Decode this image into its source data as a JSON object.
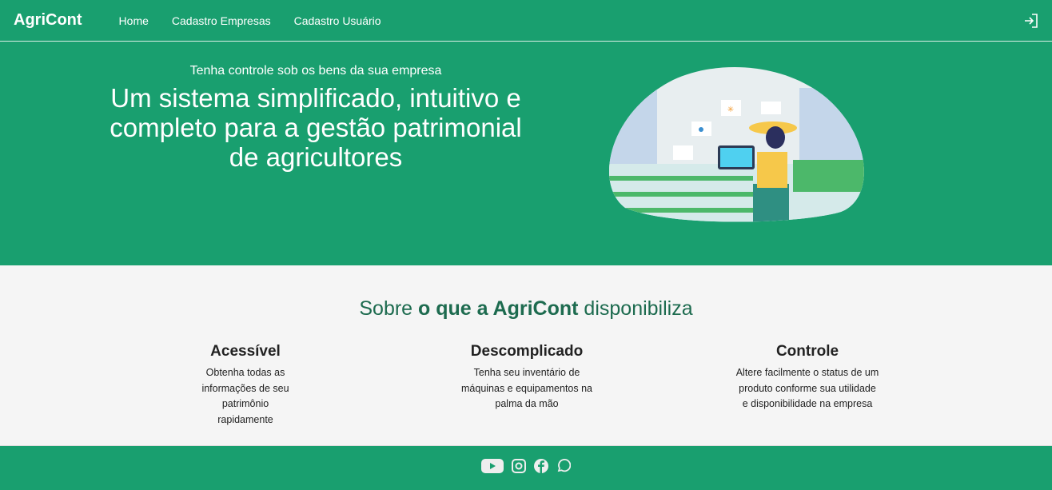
{
  "nav": {
    "brand": "AgriCont",
    "links": [
      "Home",
      "Cadastro Empresas",
      "Cadastro Usuário"
    ]
  },
  "hero": {
    "subtitle": "Tenha controle sob os bens da sua empresa",
    "title": "Um sistema simplificado, intuitivo e completo para a gestão patrimonial de agricultores"
  },
  "about": {
    "title_pre": "Sobre ",
    "title_bold": "o que a AgriCont",
    "title_post": " disponibiliza",
    "features": [
      {
        "title": "Acessível",
        "text": "Obtenha todas as informações de seu patrimônio rapidamente"
      },
      {
        "title": "Descomplicado",
        "text": "Tenha seu inventário de máquinas e equipamentos na palma da mão"
      },
      {
        "title": "Controle",
        "text": "Altere facilmente o status de um produto conforme sua utilidade e disponibilidade na empresa"
      }
    ]
  },
  "footer": {
    "icons": [
      "youtube-icon",
      "instagram-icon",
      "facebook-icon",
      "whatsapp-icon"
    ]
  },
  "colors": {
    "primary": "#199f6f",
    "heading": "#1d6b4f"
  }
}
